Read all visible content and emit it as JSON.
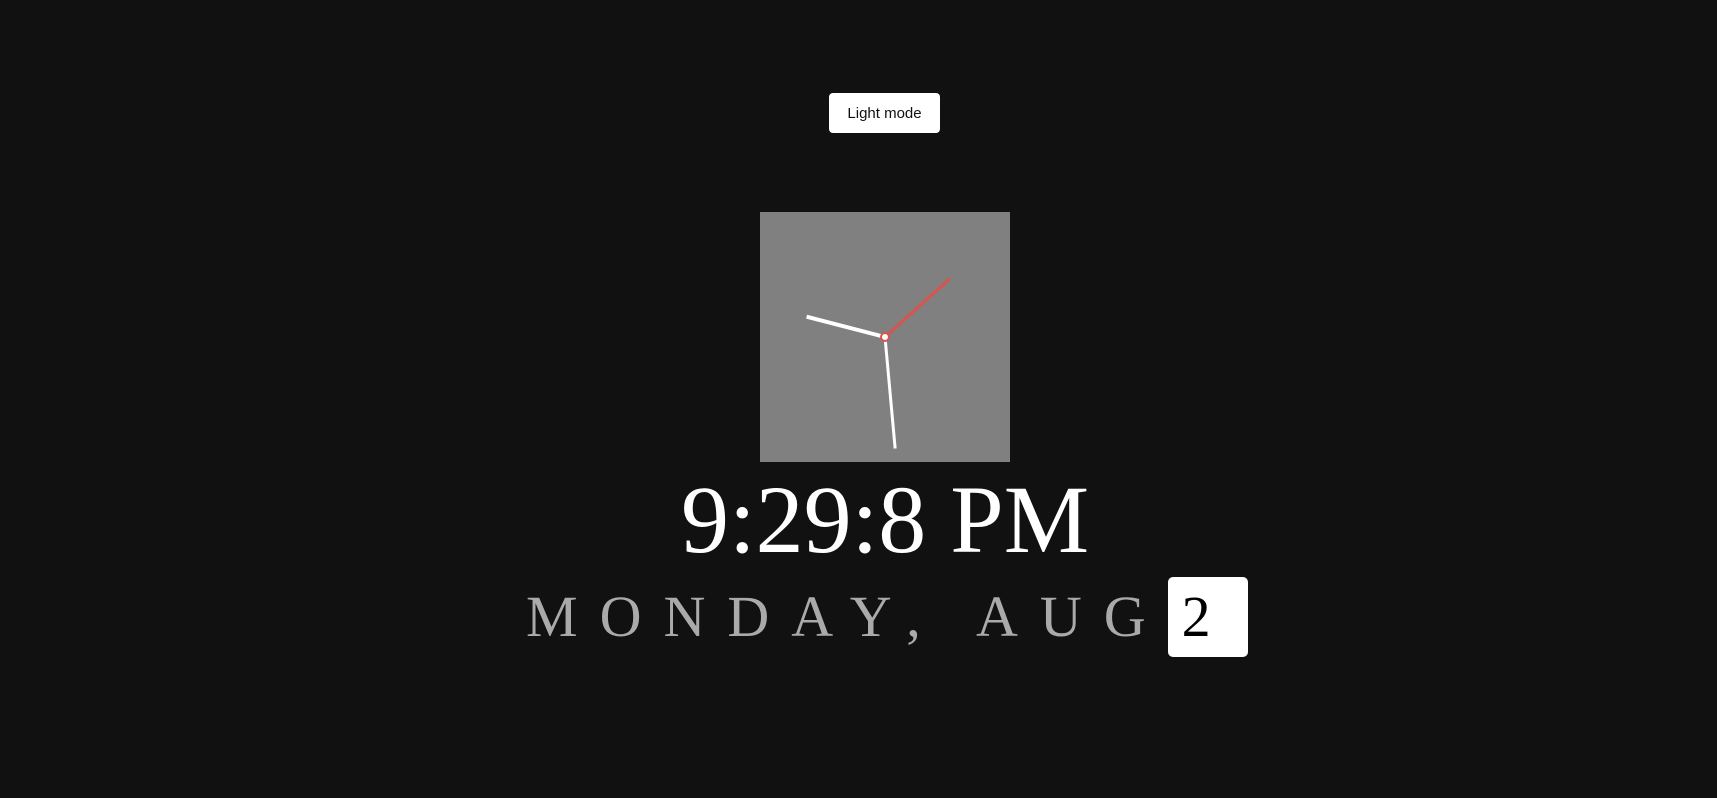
{
  "toolbar": {
    "mode_toggle_label": "Light mode"
  },
  "clock": {
    "hour": 9,
    "minute": 29,
    "second": 8,
    "face_color": "#808080",
    "hand_color": "#ffffff",
    "second_hand_color": "#d9534f"
  },
  "time_readout": "9:29:8 PM",
  "date": {
    "label": "MONDAY, AUG",
    "day": "2"
  },
  "colors": {
    "background": "#111111",
    "date_text": "#aaaaaa"
  }
}
